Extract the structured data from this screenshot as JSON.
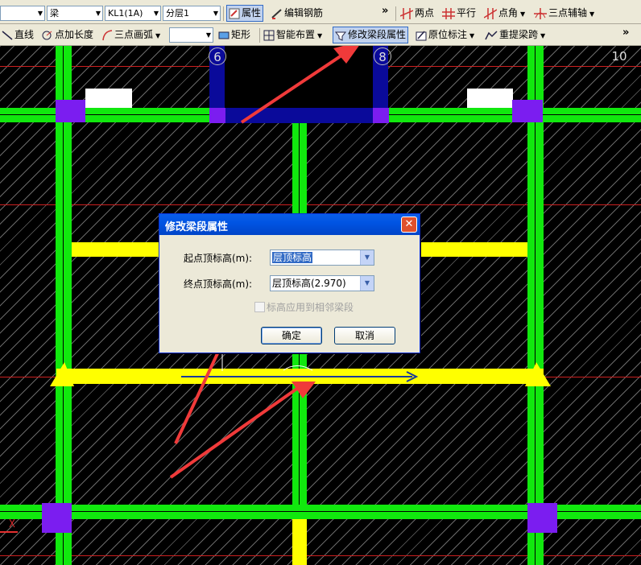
{
  "toolbar1": {
    "combo_type_value": "梁",
    "combo_name_value": "KL1(1A)",
    "combo_floor_value": "分层1",
    "btn_properties": "属性",
    "btn_edit_rebar": "编辑钢筋",
    "overflow": "»",
    "btn_two_points": "两点",
    "btn_parallel": "平行",
    "btn_point_angle": "点角",
    "btn_three_point_axis": "三点辅轴"
  },
  "toolbar2": {
    "btn_line": "直线",
    "btn_point_length": "点加长度",
    "btn_three_point_arc": "三点画弧",
    "btn_rectangle": "矩形",
    "btn_smart_layout": "智能布置",
    "btn_modify_segment": "修改梁段属性",
    "btn_in_situ_label": "原位标注",
    "btn_re_extract_span": "重提梁跨",
    "overflow": "»"
  },
  "canvas": {
    "axis_labels": [
      "6",
      "8",
      "10"
    ]
  },
  "dialog": {
    "title": "修改梁段属性",
    "close_glyph": "✕",
    "start_label": "起点顶标高(m):",
    "start_value": "层顶标高",
    "end_label": "终点顶标高(m):",
    "end_value": "层顶标高(2.970)",
    "apply_adjacent_label": "标高应用到相邻梁段",
    "ok_label": "确定",
    "cancel_label": "取消"
  },
  "colors": {
    "beam_green": "#11e80e",
    "beam_yellow": "#ffff00",
    "column_purple": "#7b1df0",
    "annotation_arrow": "#f03a3a"
  }
}
